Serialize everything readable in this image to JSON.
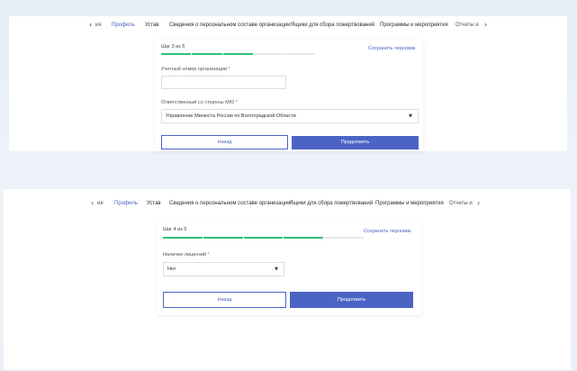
{
  "tabs": {
    "prev_label": "‹",
    "next_label": "›",
    "items": [
      {
        "label": "ия"
      },
      {
        "label": "Профиль"
      },
      {
        "label": "Устав"
      },
      {
        "label": "Сведения о персональном составе организации"
      },
      {
        "label": "Ящики для сбора пожертвований"
      },
      {
        "label": "Программы и мероприятия"
      },
      {
        "label": "Отчеты и"
      }
    ]
  },
  "form1": {
    "step": "Шаг 3 из 5",
    "save_draft": "Сохранить черновик",
    "progress": {
      "done": 3,
      "total": 5
    },
    "field1_label": "Учетный номер организации",
    "field1_value": "",
    "field2_label": "Ответственный со стороны МЮ",
    "field2_value": "Управление Минюста России по Волгоградской Области",
    "back": "Назад",
    "next": "Продолжить"
  },
  "form2": {
    "step": "Шаг 4 из 5",
    "save_draft": "Сохранить черновик",
    "progress": {
      "done": 4,
      "total": 5
    },
    "field1_label": "Наличие лицензий",
    "field1_value": "Нет",
    "back": "Назад",
    "next": "Продолжить"
  },
  "colors": {
    "accent": "#4b64c4",
    "progress_done": "#2fbf7c",
    "required": "#e0533d"
  }
}
